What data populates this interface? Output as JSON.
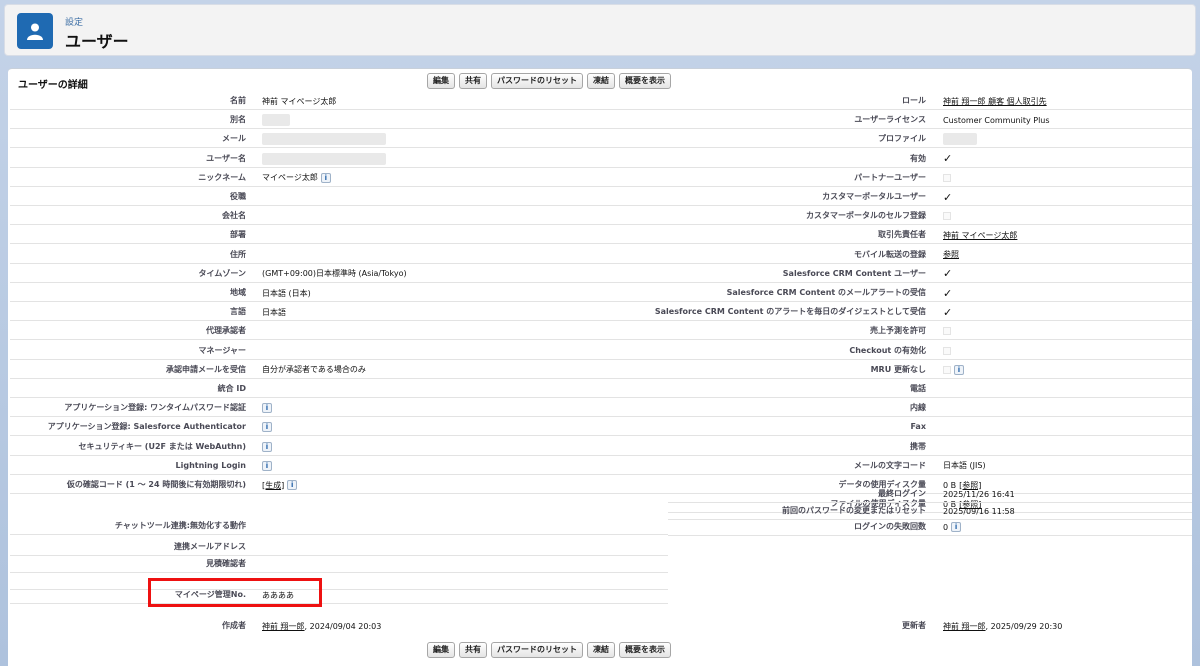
{
  "header": {
    "subtitle": "設定",
    "title": "ユーザー"
  },
  "section_title": "ユーザーの詳細",
  "buttons": [
    "編集",
    "共有",
    "パスワードのリセット",
    "凍結",
    "概要を表示"
  ],
  "left": [
    {
      "label": "名前",
      "value": "神前 マイページ太郎"
    },
    {
      "label": "別名",
      "blur": 28
    },
    {
      "label": "メール",
      "blur": 124
    },
    {
      "label": "ユーザー名",
      "blur": 124
    },
    {
      "label": "ニックネーム",
      "value": "マイページ太郎",
      "info": true
    },
    {
      "label": "役職"
    },
    {
      "label": "会社名"
    },
    {
      "label": "部署"
    },
    {
      "label": "住所"
    },
    {
      "label": "タイムゾーン",
      "value": "(GMT+09:00)日本標準時 (Asia/Tokyo)"
    },
    {
      "label": "地域",
      "value": "日本語 (日本)"
    },
    {
      "label": "言語",
      "value": "日本語"
    },
    {
      "label": "代理承認者"
    },
    {
      "label": "マネージャー"
    },
    {
      "label": "承認申請メールを受信",
      "value": "自分が承認者である場合のみ"
    },
    {
      "label": "統合 ID"
    },
    {
      "label": "アプリケーション登録: ワンタイムパスワード認証",
      "info": true
    },
    {
      "label": "アプリケーション登録: Salesforce Authenticator",
      "info": true
    },
    {
      "label": "セキュリティキー (U2F または WebAuthn)",
      "info": true
    },
    {
      "label": "Lightning Login",
      "info": true
    },
    {
      "label": "仮の確認コード (1 ～ 24 時間後に有効期限切れ)",
      "link": "[生成]",
      "info": true
    }
  ],
  "left_lower": [
    {
      "label": "チャットツール連携:無効化する動作"
    },
    {
      "label": "連携メールアドレス"
    },
    {
      "label": "見積確認者"
    },
    {
      "label": ""
    },
    {
      "label": "マイページ管理No.",
      "value": "ああああ"
    }
  ],
  "right": [
    {
      "label": "ロール",
      "link": "神前 翔一郎 顧客 個人取引先"
    },
    {
      "label": "ユーザーライセンス",
      "value": "Customer Community Plus"
    },
    {
      "label": "プロファイル",
      "blur": 34
    },
    {
      "label": "有効",
      "check": true
    },
    {
      "label": "パートナーユーザー",
      "check": false
    },
    {
      "label": "カスタマーポータルユーザー",
      "check": true
    },
    {
      "label": "カスタマーポータルのセルフ登録",
      "check": false
    },
    {
      "label": "取引先責任者",
      "link": "神前 マイページ太郎"
    },
    {
      "label": "モバイル転送の登録",
      "link": "参照"
    },
    {
      "label": "Salesforce CRM Content ユーザー",
      "check": true
    },
    {
      "label": "Salesforce CRM Content のメールアラートの受信",
      "check": true
    },
    {
      "label": "Salesforce CRM Content のアラートを毎日のダイジェストとして受信",
      "check": true
    },
    {
      "label": "売上予測を許可",
      "check": false
    },
    {
      "label": "Checkout の有効化",
      "check": false
    },
    {
      "label": "MRU 更新なし",
      "check": false,
      "info": true
    },
    {
      "label": "電話"
    },
    {
      "label": "内線"
    },
    {
      "label": "Fax"
    },
    {
      "label": "携帯"
    },
    {
      "label": "メールの文字コード",
      "value": "日本語 (JIS)"
    },
    {
      "label": "データの使用ディスク量",
      "value": "0 B",
      "link": "[参照]"
    },
    {
      "label": "ファイルの使用ディスク量",
      "value": "0 B",
      "link": "[参照]"
    },
    {
      "label": "最終ログイン",
      "value": "2025/11/26 16:41"
    },
    {
      "label": "前回のパスワードの変更またはリセット",
      "value": "2025/09/16 11:58"
    },
    {
      "label": "ログインの失敗回数",
      "value": "0",
      "info": true
    }
  ],
  "created": {
    "label": "作成者",
    "link": "神前 翔一郎",
    "date": ", 2024/09/04 20:03"
  },
  "modified": {
    "label": "更新者",
    "link": "神前 翔一郎",
    "date": ", 2025/09/29 20:30"
  }
}
